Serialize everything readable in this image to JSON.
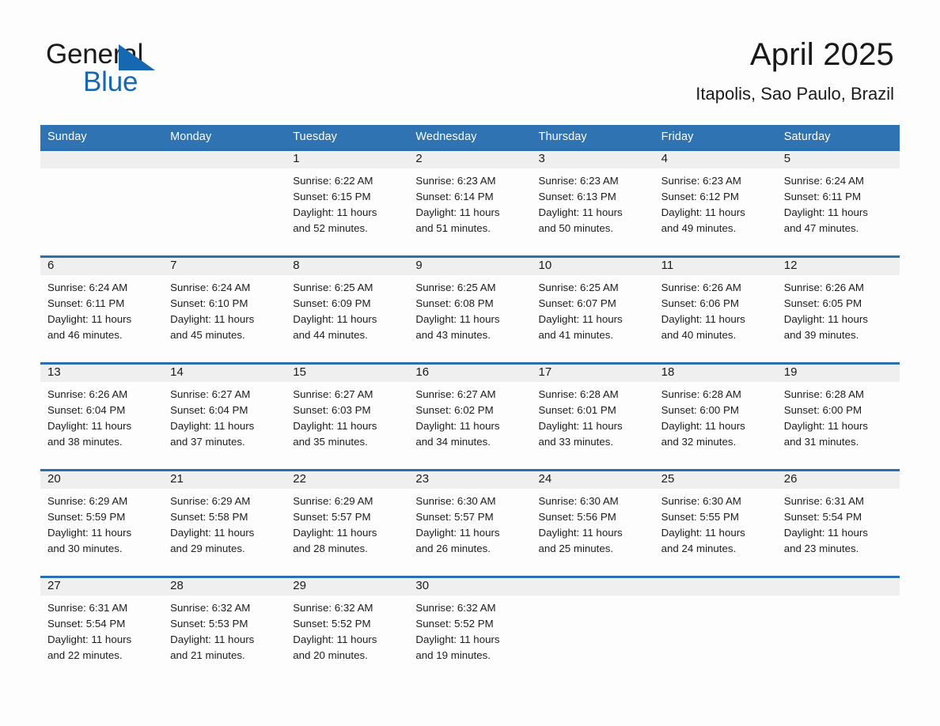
{
  "brand": {
    "name_part1": "General",
    "name_part2": "Blue",
    "logo_icon": "triangle-flag-icon",
    "accent_color": "#1668b3"
  },
  "header": {
    "title": "April 2025",
    "location": "Itapolis, Sao Paulo, Brazil"
  },
  "colors": {
    "header_row_bg": "#2f73b3",
    "week_separator": "#2a6fb0",
    "day_strip_bg": "#efefef",
    "page_bg": "#fdfdfd",
    "text": "#1b1b1b"
  },
  "day_names": [
    "Sunday",
    "Monday",
    "Tuesday",
    "Wednesday",
    "Thursday",
    "Friday",
    "Saturday"
  ],
  "labels": {
    "sunrise_prefix": "Sunrise:",
    "sunset_prefix": "Sunset:",
    "daylight_prefix": "Daylight:"
  },
  "weeks": [
    [
      {
        "empty": true
      },
      {
        "empty": true
      },
      {
        "day": "1",
        "sunrise": "Sunrise: 6:22 AM",
        "sunset": "Sunset: 6:15 PM",
        "daylight_l1": "Daylight: 11 hours",
        "daylight_l2": "and 52 minutes."
      },
      {
        "day": "2",
        "sunrise": "Sunrise: 6:23 AM",
        "sunset": "Sunset: 6:14 PM",
        "daylight_l1": "Daylight: 11 hours",
        "daylight_l2": "and 51 minutes."
      },
      {
        "day": "3",
        "sunrise": "Sunrise: 6:23 AM",
        "sunset": "Sunset: 6:13 PM",
        "daylight_l1": "Daylight: 11 hours",
        "daylight_l2": "and 50 minutes."
      },
      {
        "day": "4",
        "sunrise": "Sunrise: 6:23 AM",
        "sunset": "Sunset: 6:12 PM",
        "daylight_l1": "Daylight: 11 hours",
        "daylight_l2": "and 49 minutes."
      },
      {
        "day": "5",
        "sunrise": "Sunrise: 6:24 AM",
        "sunset": "Sunset: 6:11 PM",
        "daylight_l1": "Daylight: 11 hours",
        "daylight_l2": "and 47 minutes."
      }
    ],
    [
      {
        "day": "6",
        "sunrise": "Sunrise: 6:24 AM",
        "sunset": "Sunset: 6:11 PM",
        "daylight_l1": "Daylight: 11 hours",
        "daylight_l2": "and 46 minutes."
      },
      {
        "day": "7",
        "sunrise": "Sunrise: 6:24 AM",
        "sunset": "Sunset: 6:10 PM",
        "daylight_l1": "Daylight: 11 hours",
        "daylight_l2": "and 45 minutes."
      },
      {
        "day": "8",
        "sunrise": "Sunrise: 6:25 AM",
        "sunset": "Sunset: 6:09 PM",
        "daylight_l1": "Daylight: 11 hours",
        "daylight_l2": "and 44 minutes."
      },
      {
        "day": "9",
        "sunrise": "Sunrise: 6:25 AM",
        "sunset": "Sunset: 6:08 PM",
        "daylight_l1": "Daylight: 11 hours",
        "daylight_l2": "and 43 minutes."
      },
      {
        "day": "10",
        "sunrise": "Sunrise: 6:25 AM",
        "sunset": "Sunset: 6:07 PM",
        "daylight_l1": "Daylight: 11 hours",
        "daylight_l2": "and 41 minutes."
      },
      {
        "day": "11",
        "sunrise": "Sunrise: 6:26 AM",
        "sunset": "Sunset: 6:06 PM",
        "daylight_l1": "Daylight: 11 hours",
        "daylight_l2": "and 40 minutes."
      },
      {
        "day": "12",
        "sunrise": "Sunrise: 6:26 AM",
        "sunset": "Sunset: 6:05 PM",
        "daylight_l1": "Daylight: 11 hours",
        "daylight_l2": "and 39 minutes."
      }
    ],
    [
      {
        "day": "13",
        "sunrise": "Sunrise: 6:26 AM",
        "sunset": "Sunset: 6:04 PM",
        "daylight_l1": "Daylight: 11 hours",
        "daylight_l2": "and 38 minutes."
      },
      {
        "day": "14",
        "sunrise": "Sunrise: 6:27 AM",
        "sunset": "Sunset: 6:04 PM",
        "daylight_l1": "Daylight: 11 hours",
        "daylight_l2": "and 37 minutes."
      },
      {
        "day": "15",
        "sunrise": "Sunrise: 6:27 AM",
        "sunset": "Sunset: 6:03 PM",
        "daylight_l1": "Daylight: 11 hours",
        "daylight_l2": "and 35 minutes."
      },
      {
        "day": "16",
        "sunrise": "Sunrise: 6:27 AM",
        "sunset": "Sunset: 6:02 PM",
        "daylight_l1": "Daylight: 11 hours",
        "daylight_l2": "and 34 minutes."
      },
      {
        "day": "17",
        "sunrise": "Sunrise: 6:28 AM",
        "sunset": "Sunset: 6:01 PM",
        "daylight_l1": "Daylight: 11 hours",
        "daylight_l2": "and 33 minutes."
      },
      {
        "day": "18",
        "sunrise": "Sunrise: 6:28 AM",
        "sunset": "Sunset: 6:00 PM",
        "daylight_l1": "Daylight: 11 hours",
        "daylight_l2": "and 32 minutes."
      },
      {
        "day": "19",
        "sunrise": "Sunrise: 6:28 AM",
        "sunset": "Sunset: 6:00 PM",
        "daylight_l1": "Daylight: 11 hours",
        "daylight_l2": "and 31 minutes."
      }
    ],
    [
      {
        "day": "20",
        "sunrise": "Sunrise: 6:29 AM",
        "sunset": "Sunset: 5:59 PM",
        "daylight_l1": "Daylight: 11 hours",
        "daylight_l2": "and 30 minutes."
      },
      {
        "day": "21",
        "sunrise": "Sunrise: 6:29 AM",
        "sunset": "Sunset: 5:58 PM",
        "daylight_l1": "Daylight: 11 hours",
        "daylight_l2": "and 29 minutes."
      },
      {
        "day": "22",
        "sunrise": "Sunrise: 6:29 AM",
        "sunset": "Sunset: 5:57 PM",
        "daylight_l1": "Daylight: 11 hours",
        "daylight_l2": "and 28 minutes."
      },
      {
        "day": "23",
        "sunrise": "Sunrise: 6:30 AM",
        "sunset": "Sunset: 5:57 PM",
        "daylight_l1": "Daylight: 11 hours",
        "daylight_l2": "and 26 minutes."
      },
      {
        "day": "24",
        "sunrise": "Sunrise: 6:30 AM",
        "sunset": "Sunset: 5:56 PM",
        "daylight_l1": "Daylight: 11 hours",
        "daylight_l2": "and 25 minutes."
      },
      {
        "day": "25",
        "sunrise": "Sunrise: 6:30 AM",
        "sunset": "Sunset: 5:55 PM",
        "daylight_l1": "Daylight: 11 hours",
        "daylight_l2": "and 24 minutes."
      },
      {
        "day": "26",
        "sunrise": "Sunrise: 6:31 AM",
        "sunset": "Sunset: 5:54 PM",
        "daylight_l1": "Daylight: 11 hours",
        "daylight_l2": "and 23 minutes."
      }
    ],
    [
      {
        "day": "27",
        "sunrise": "Sunrise: 6:31 AM",
        "sunset": "Sunset: 5:54 PM",
        "daylight_l1": "Daylight: 11 hours",
        "daylight_l2": "and 22 minutes."
      },
      {
        "day": "28",
        "sunrise": "Sunrise: 6:32 AM",
        "sunset": "Sunset: 5:53 PM",
        "daylight_l1": "Daylight: 11 hours",
        "daylight_l2": "and 21 minutes."
      },
      {
        "day": "29",
        "sunrise": "Sunrise: 6:32 AM",
        "sunset": "Sunset: 5:52 PM",
        "daylight_l1": "Daylight: 11 hours",
        "daylight_l2": "and 20 minutes."
      },
      {
        "day": "30",
        "sunrise": "Sunrise: 6:32 AM",
        "sunset": "Sunset: 5:52 PM",
        "daylight_l1": "Daylight: 11 hours",
        "daylight_l2": "and 19 minutes."
      },
      {
        "empty": true
      },
      {
        "empty": true
      },
      {
        "empty": true
      }
    ]
  ]
}
